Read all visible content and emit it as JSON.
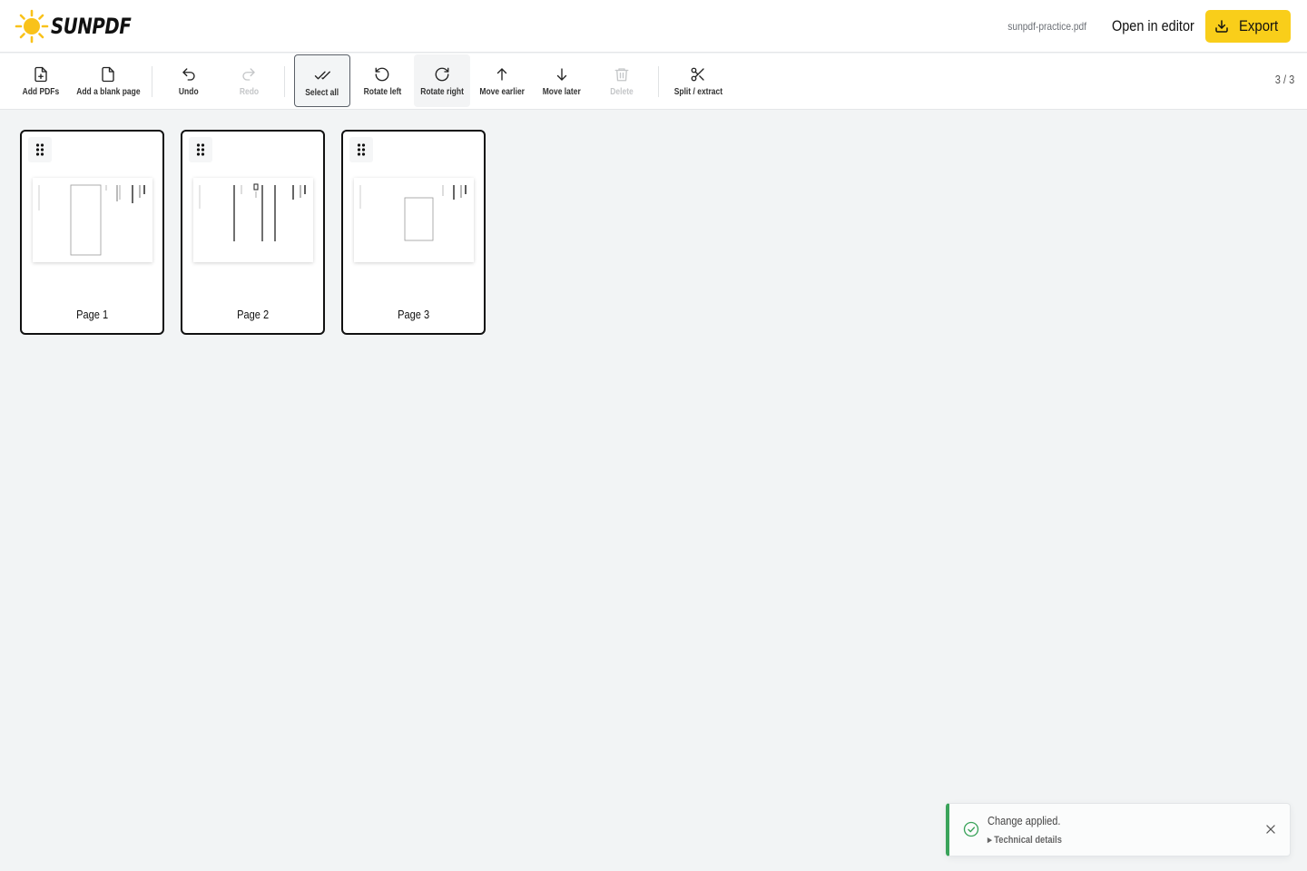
{
  "app": {
    "brand": "SUNPDF"
  },
  "header": {
    "filename": "sunpdf-practice.pdf",
    "open_editor_label": "Open in editor",
    "export_label": "Export"
  },
  "toolbar": {
    "add_pdfs": "Add PDFs",
    "add_blank": "Add a blank page",
    "undo": "Undo",
    "redo": "Redo",
    "select_all": "Select all",
    "rotate_left": "Rotate left",
    "rotate_right": "Rotate right",
    "move_earlier": "Move earlier",
    "move_later": "Move later",
    "delete": "Delete",
    "split_extract": "Split / extract",
    "page_count": "3 / 3"
  },
  "pages": [
    {
      "label": "Page 1",
      "selected": true
    },
    {
      "label": "Page 2",
      "selected": true
    },
    {
      "label": "Page 3",
      "selected": true
    }
  ],
  "toast": {
    "message": "Change applied.",
    "details_label": "▸ Technical details",
    "status_color": "#3aa35a"
  },
  "colors": {
    "accent": "#f9ce1a",
    "success": "#3aa35a"
  },
  "icons": [
    "sun-logo-icon",
    "file-plus-icon",
    "file-icon",
    "undo-icon",
    "redo-icon",
    "check-double-icon",
    "rotate-left-icon",
    "rotate-right-icon",
    "arrow-up-icon",
    "arrow-down-icon",
    "trash-icon",
    "scissors-icon",
    "download-icon",
    "drag-handle-icon",
    "check-circle-icon",
    "close-icon"
  ]
}
